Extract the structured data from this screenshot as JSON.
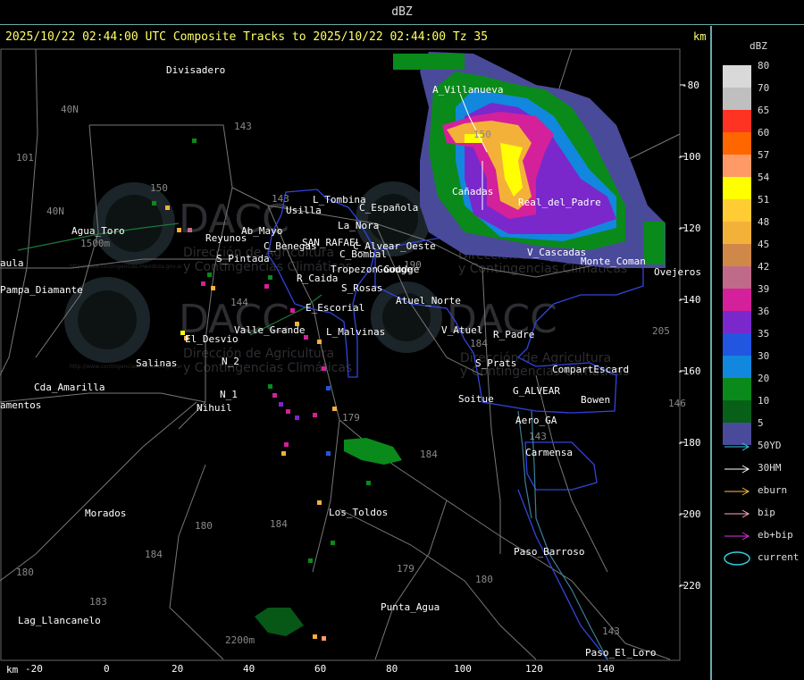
{
  "header": {
    "title": "dBZ"
  },
  "map": {
    "title": "2025/10/22 02:44:00 UTC Composite Tracks to 2025/10/22 02:44:00 Tz 35",
    "km_unit_top": "km",
    "km_unit_bottom": "km",
    "x_ticks": [
      "-20",
      "0",
      "20",
      "40",
      "60",
      "80",
      "100",
      "120",
      "140"
    ],
    "y_ticks": [
      "-80",
      "-100",
      "-120",
      "-140",
      "-160",
      "-180",
      "-200",
      "-220"
    ],
    "places": [
      "Divisadero",
      "Usilla",
      "L_Tombina",
      "C_Española",
      "La_Nora",
      "C_Benegas",
      "SAN_RAFAEL",
      "C_Alvear_Oeste",
      "C_Bombal",
      "R_Caida",
      "Tropezon Goudge",
      "S_Rosas",
      "E_Escorial",
      "Atuel_Norte",
      "Valle_Grande",
      "L_Malvinas",
      "V_Atuel",
      "R_Padre",
      "El_Desvio",
      "S_Pintada",
      "Reyunos",
      "Ab_Mayo",
      "Salinas",
      "N_2",
      "N_1",
      "Nihuil",
      "Cda_Amarilla",
      "amentos",
      "Agua_Toro",
      "Pampa_Diamante",
      "aula",
      "Morados",
      "Los_Toldos",
      "Lag_Llancanelo",
      "Punta_Agua",
      "Paso_Barroso",
      "Paso_El_Loro",
      "Carmensa",
      "Aero_GA",
      "G_ALVEAR",
      "Bowen",
      "CompartEscard",
      "S_Prats",
      "Soitue",
      "Ovejeros",
      "Goudge",
      "A_Villanueva",
      "Cañadas",
      "Real_del_Padre",
      "Monte_Coman",
      "V_Cascadas"
    ],
    "route_numbers": [
      "143",
      "40N",
      "101",
      "40N",
      "150",
      "143",
      "144",
      "184",
      "180",
      "184",
      "184",
      "179",
      "179",
      "180",
      "183",
      "143",
      "146",
      "205",
      "143",
      "190",
      "180",
      "184",
      "150"
    ],
    "elevations": [
      "1500m",
      "2200m"
    ],
    "watermark": {
      "org": "DACC",
      "line1": "Dirección de Agricultura",
      "line2": "y Contingencias Climáticas",
      "url": "http://www.contingencias.mendoza.gov.ar"
    }
  },
  "legend": {
    "title": "dBZ",
    "levels": [
      {
        "value": "80",
        "color": "#d9d9d9"
      },
      {
        "value": "70",
        "color": "#bfbfbf"
      },
      {
        "value": "65",
        "color": "#ff3322"
      },
      {
        "value": "60",
        "color": "#ff6600"
      },
      {
        "value": "57",
        "color": "#ff9966"
      },
      {
        "value": "54",
        "color": "#ffff00"
      },
      {
        "value": "51",
        "color": "#ffcc33"
      },
      {
        "value": "48",
        "color": "#f4b13a"
      },
      {
        "value": "45",
        "color": "#d08848"
      },
      {
        "value": "42",
        "color": "#c06a8a"
      },
      {
        "value": "39",
        "color": "#d4209a"
      },
      {
        "value": "36",
        "color": "#7a28cc"
      },
      {
        "value": "35",
        "color": "#2255e0"
      },
      {
        "value": "30",
        "color": "#1188dd"
      },
      {
        "value": "20",
        "color": "#0a8a1a"
      },
      {
        "value": "10",
        "color": "#086018"
      },
      {
        "value": "5",
        "color": "#4a4a9a"
      }
    ],
    "tracks": [
      {
        "label": "50YD",
        "color": "#33ccdd"
      },
      {
        "label": "30HM",
        "color": "#ffffff"
      },
      {
        "label": "eburn",
        "color": "#ffbb44"
      },
      {
        "label": "bip",
        "color": "#ffaacc"
      },
      {
        "label": "eb+bip",
        "color": "#dd33dd"
      },
      {
        "label": "current",
        "color": "#33ccdd"
      }
    ]
  }
}
